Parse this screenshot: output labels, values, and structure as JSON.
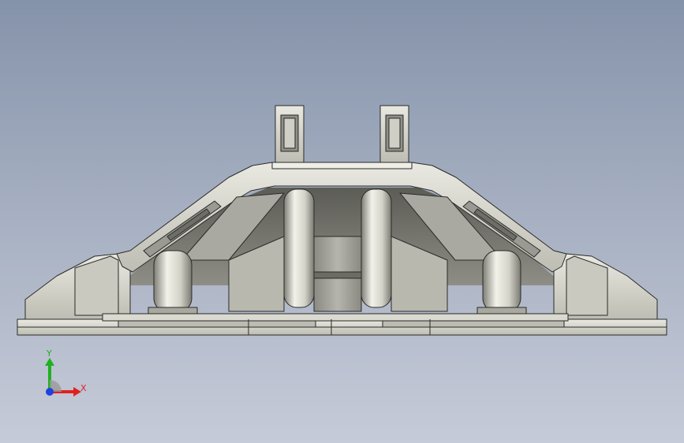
{
  "view": {
    "background_top": "#8593aa",
    "background_bottom": "#c6cbd8",
    "part_color": "#d6d6cc",
    "edge_color": "#2a2a2a"
  },
  "triad": {
    "x_label": "X",
    "y_label": "Y",
    "x_color": "#e02020",
    "y_color": "#20b020",
    "z_color": "#2040e0"
  }
}
